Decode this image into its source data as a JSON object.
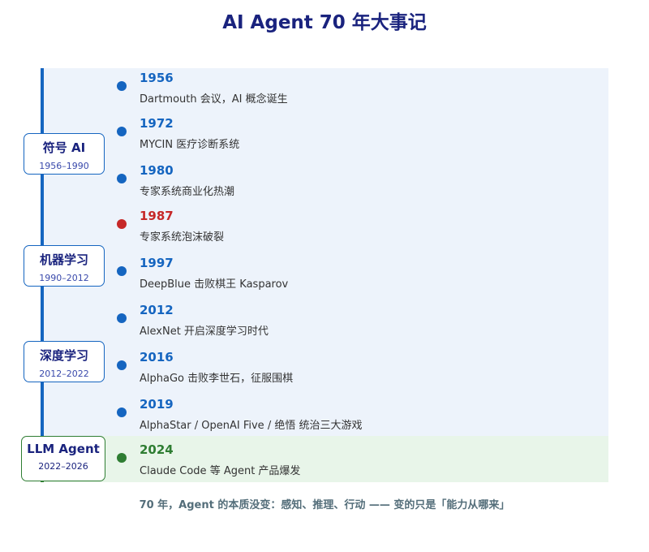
{
  "title": "AI Agent 70 年大事记",
  "eras": [
    {
      "name": "符号 AI",
      "range": "1956–1990"
    },
    {
      "name": "机器学习",
      "range": "1990–2012"
    },
    {
      "name": "深度学习",
      "range": "2012–2022"
    },
    {
      "name": "LLM Agent",
      "range": "2022–2026"
    }
  ],
  "events": [
    {
      "year": "1956",
      "desc": "Dartmouth 会议，AI 概念诞生"
    },
    {
      "year": "1972",
      "desc": "MYCIN 医疗诊断系统"
    },
    {
      "year": "1980",
      "desc": "专家系统商业化热潮"
    },
    {
      "year": "1987",
      "desc": "专家系统泡沫破裂"
    },
    {
      "year": "1997",
      "desc": "DeepBlue 击败棋王 Kasparov"
    },
    {
      "year": "2012",
      "desc": "AlexNet 开启深度学习时代"
    },
    {
      "year": "2016",
      "desc": "AlphaGo 击败李世石，征服围棋"
    },
    {
      "year": "2019",
      "desc": "AlphaStar / OpenAI Five / 绝悟 统治三大游戏"
    },
    {
      "year": "2024",
      "desc": "Claude Code 等 Agent 产品爆发"
    }
  ],
  "colors": {
    "primary": "#1565c0",
    "highlight_red": "#c62828",
    "agent_green": "#2e7d32",
    "title_navy": "#1a237e",
    "panel_blue": "#edf3fb",
    "panel_green": "#e8f5e9"
  },
  "footer": "70 年，Agent 的本质没变：感知、推理、行动 —— 变的只是「能力从哪来」"
}
